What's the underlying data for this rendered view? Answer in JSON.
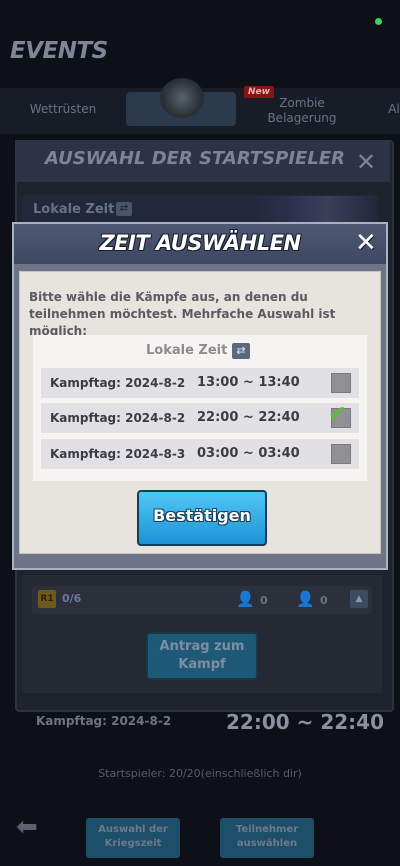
{
  "header": {
    "title": "EVENTS"
  },
  "tabs": [
    {
      "label": "Wettrüsten"
    },
    {
      "label": "Zombie Belagerung",
      "badge": "New"
    },
    {
      "label": "Al"
    }
  ],
  "background_panel": {
    "title": "AUSWAHL DER STARTSPIELER",
    "local_time_label": "Lokale Zeit",
    "round_badge": "R1",
    "round_count": "0/6",
    "assigned_count_1": "0",
    "assigned_count_2": "0",
    "request_button": "Antrag zum Kampf",
    "selected_day": "Kampftag: 2024-8-2",
    "selected_time": "22:00 ~ 22:40",
    "starters_text": "Startspieler:  20/20(einschließlich dir)"
  },
  "bottom_bar": {
    "war_time_button": "Auswahl der Kriegszeit",
    "participants_button": "Teilnehmer auswählen"
  },
  "modal": {
    "title": "ZEIT AUSWÄHLEN",
    "instruction": "Bitte wähle die Kämpfe aus, an denen du teilnehmen möchtest. Mehrfache Auswahl ist möglich:",
    "local_time_label": "Lokale Zeit",
    "slots": [
      {
        "day": "Kampftag: 2024-8-2",
        "time": "13:00 ~ 13:40",
        "selected": false
      },
      {
        "day": "Kampftag: 2024-8-2",
        "time": "22:00 ~ 22:40",
        "selected": true
      },
      {
        "day": "Kampftag: 2024-8-3",
        "time": "03:00 ~ 03:40",
        "selected": false
      }
    ],
    "confirm_button": "Bestätigen"
  },
  "colors": {
    "confirm": "#1c93d5",
    "check": "#5dbb3b",
    "status_dot": "#37d35a"
  },
  "icons": [
    "close-icon",
    "swap-icon",
    "checkmark-icon",
    "back-arrow-icon",
    "person-icon"
  ]
}
